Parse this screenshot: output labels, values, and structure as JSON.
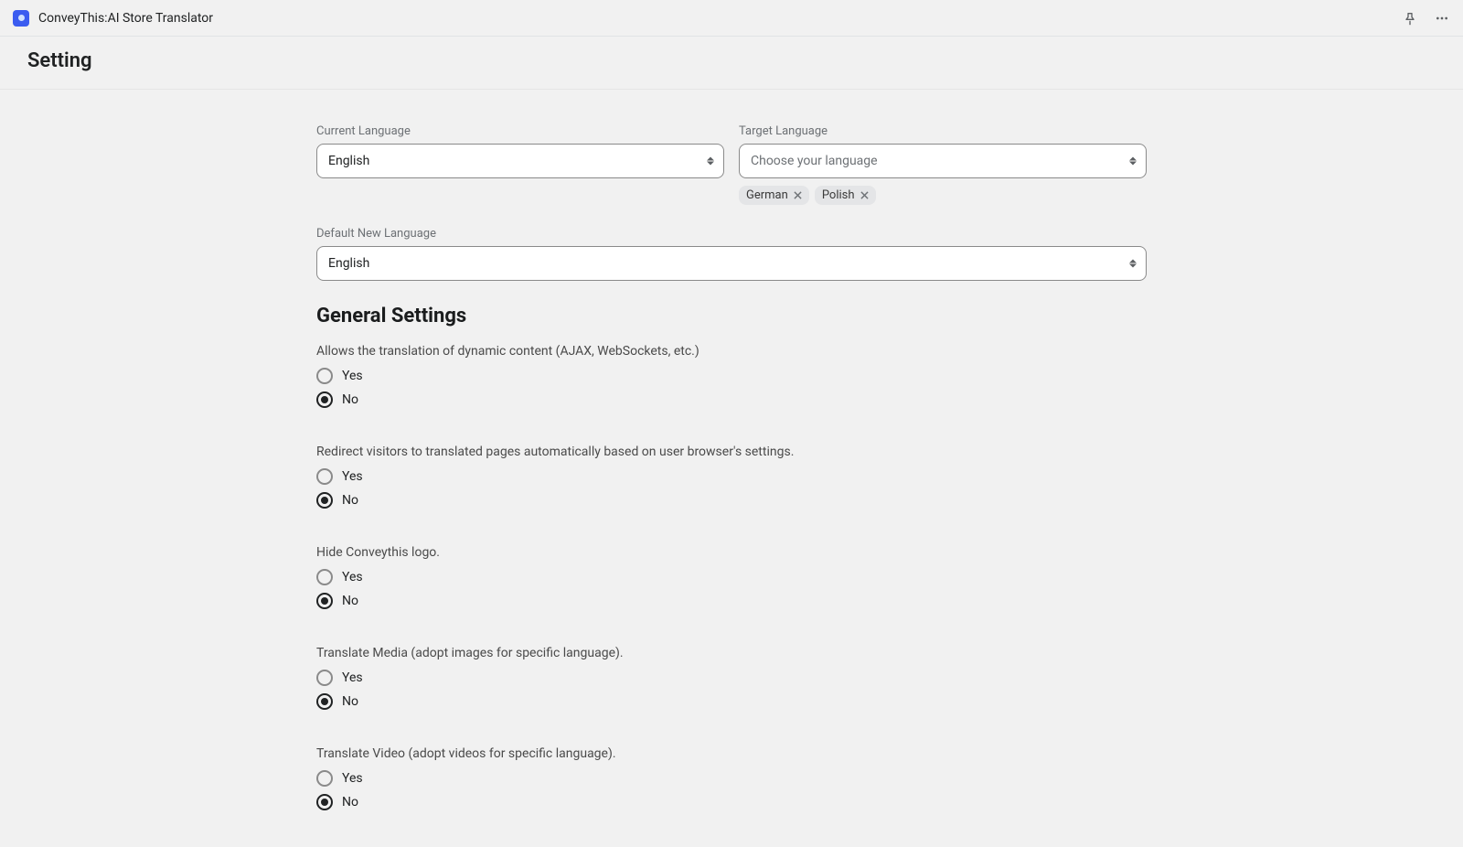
{
  "header": {
    "app_name": "ConveyThis:AI Store Translator"
  },
  "page": {
    "title": "Setting"
  },
  "form": {
    "current_language_label": "Current Language",
    "current_language_value": "English",
    "target_language_label": "Target Language",
    "target_language_placeholder": "Choose your language",
    "target_language_tags": [
      "German",
      "Polish"
    ],
    "default_new_language_label": "Default New Language",
    "default_new_language_value": "English"
  },
  "section": {
    "general_title": "General Settings"
  },
  "settings": [
    {
      "label": "Allows the translation of dynamic content (AJAX, WebSockets, etc.)",
      "yes": "Yes",
      "no": "No",
      "selected": "No"
    },
    {
      "label": "Redirect visitors to translated pages automatically based on user browser's settings.",
      "yes": "Yes",
      "no": "No",
      "selected": "No"
    },
    {
      "label": "Hide Conveythis logo.",
      "yes": "Yes",
      "no": "No",
      "selected": "No"
    },
    {
      "label": "Translate Media (adopt images for specific language).",
      "yes": "Yes",
      "no": "No",
      "selected": "No"
    },
    {
      "label": "Translate Video (adopt videos for specific language).",
      "yes": "Yes",
      "no": "No",
      "selected": "No"
    }
  ]
}
